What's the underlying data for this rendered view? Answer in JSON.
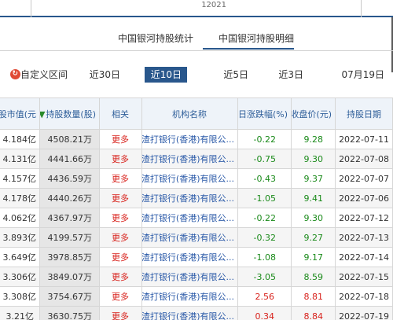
{
  "top": {
    "date_label": "12021"
  },
  "tabs": [
    {
      "label": "中国银河持股统计",
      "active": false
    },
    {
      "label": "中国银河持股明细",
      "active": true
    }
  ],
  "periods": [
    {
      "label": "07月19日",
      "active": false
    },
    {
      "label": "近3日",
      "active": false
    },
    {
      "label": "近5日",
      "active": false
    },
    {
      "label": "近10日",
      "active": true
    },
    {
      "label": "近30日",
      "active": false
    },
    {
      "label": "自定义区间",
      "active": false
    }
  ],
  "table": {
    "headers": [
      "持股日期",
      "当日收盘价(元)",
      "当日涨跌幅(%)",
      "机构名称",
      "相关",
      "持股数量(股)",
      "持股市值(元"
    ],
    "rows": [
      [
        "2022-07-11",
        "9.28",
        "-0.22",
        "渣打银行(香港)有限公...",
        "更多",
        "4508.21万",
        "4.184亿"
      ],
      [
        "2022-07-08",
        "9.30",
        "-0.75",
        "渣打银行(香港)有限公...",
        "更多",
        "4441.66万",
        "4.131亿"
      ],
      [
        "2022-07-07",
        "9.37",
        "-0.43",
        "渣打银行(香港)有限公...",
        "更多",
        "4436.59万",
        "4.157亿"
      ],
      [
        "2022-07-06",
        "9.41",
        "-1.05",
        "渣打银行(香港)有限公...",
        "更多",
        "4440.26万",
        "4.178亿"
      ],
      [
        "2022-07-12",
        "9.30",
        "-0.22",
        "渣打银行(香港)有限公...",
        "更多",
        "4367.97万",
        "4.062亿"
      ],
      [
        "2022-07-13",
        "9.27",
        "-0.32",
        "渣打银行(香港)有限公...",
        "更多",
        "4199.57万",
        "3.893亿"
      ],
      [
        "2022-07-14",
        "9.17",
        "-1.08",
        "渣打银行(香港)有限公...",
        "更多",
        "3978.85万",
        "3.649亿"
      ],
      [
        "2022-07-15",
        "8.59",
        "-3.05",
        "渣打银行(香港)有限公...",
        "更多",
        "3849.07万",
        "3.306亿"
      ],
      [
        "2022-07-18",
        "8.81",
        "2.56",
        "渣打银行(香港)有限公...",
        "更多",
        "3754.67万",
        "3.308亿"
      ],
      [
        "2022-07-19",
        "8.84",
        "0.34",
        "渣打银行(香港)有限公...",
        "更多",
        "3630.75万",
        "3.21亿"
      ]
    ]
  }
}
